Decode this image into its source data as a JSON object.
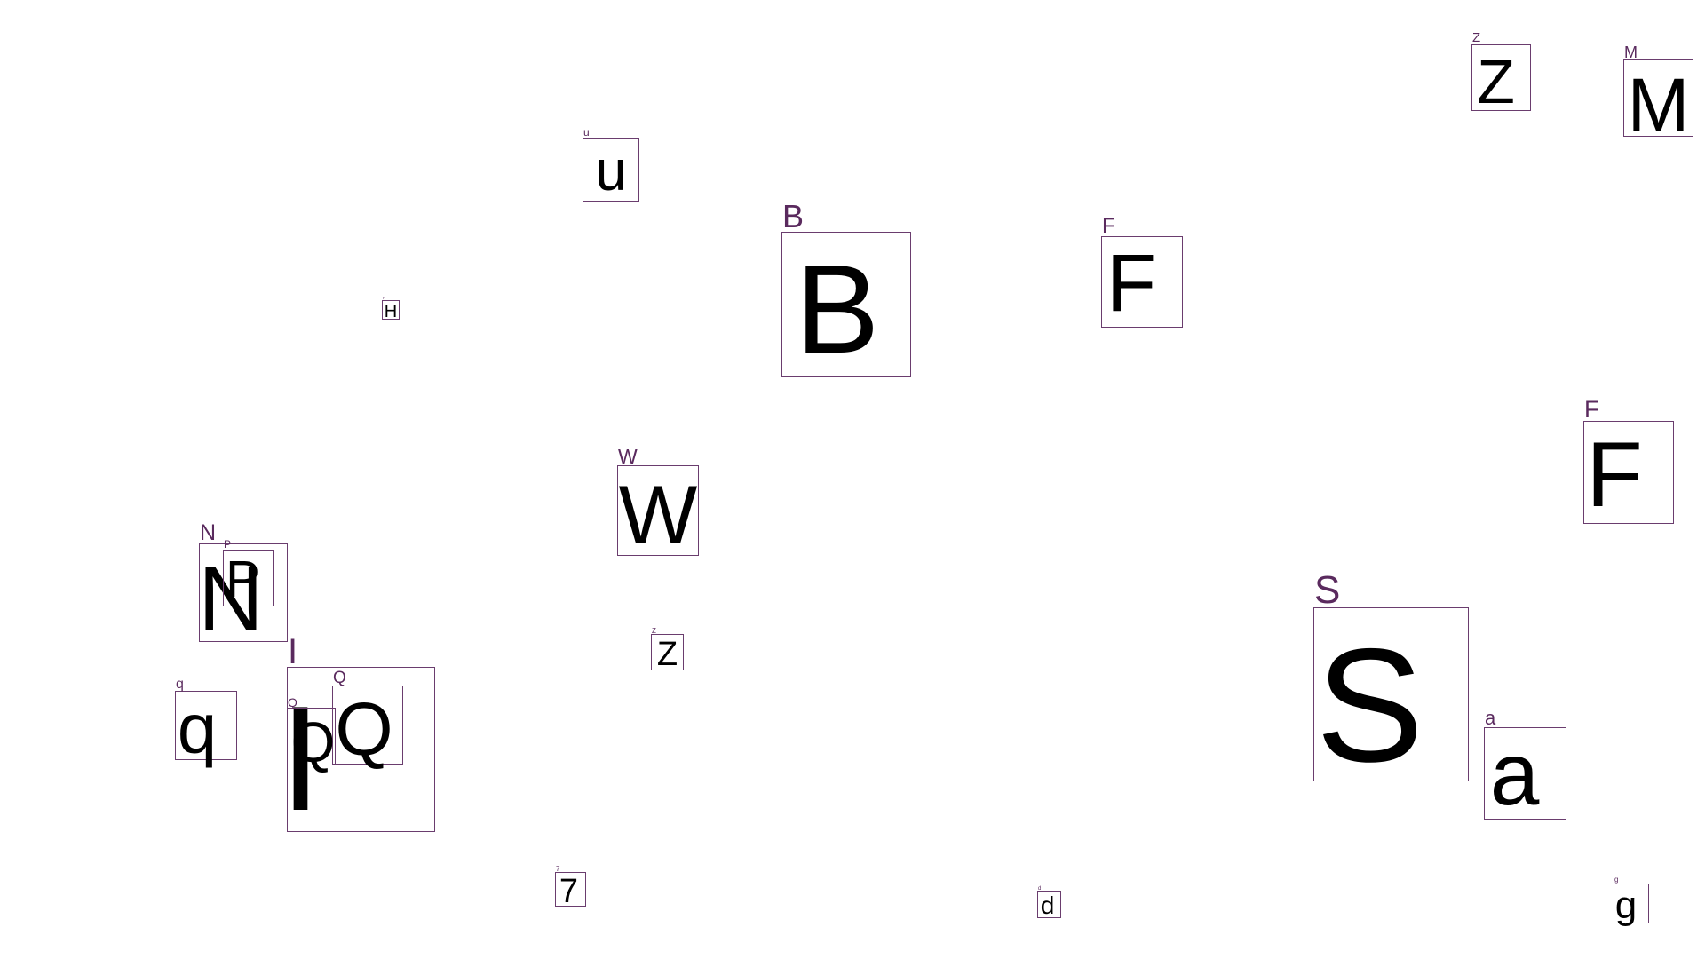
{
  "colors": {
    "background": "#ffffff",
    "box_border": "#6a3d6e",
    "label": "#5a2a5e",
    "glyph": "#000000"
  },
  "detections": [
    {
      "label": "u",
      "glyph": "u"
    },
    {
      "label": "H",
      "glyph": "H"
    },
    {
      "label": "B",
      "glyph": "B"
    },
    {
      "label": "F",
      "glyph": "F"
    },
    {
      "label": "Z",
      "glyph": "Z"
    },
    {
      "label": "M",
      "glyph": "M"
    },
    {
      "label": "F",
      "glyph": "F"
    },
    {
      "label": "W",
      "glyph": "W"
    },
    {
      "label": "N",
      "glyph": "N"
    },
    {
      "label": "P",
      "glyph": "P"
    },
    {
      "label": "Z",
      "glyph": "Z"
    },
    {
      "label": "I",
      "glyph": "I"
    },
    {
      "label": "Q",
      "glyph": "Q"
    },
    {
      "label": "Q",
      "glyph": "Q"
    },
    {
      "label": "q",
      "glyph": "q"
    },
    {
      "label": "S",
      "glyph": "S"
    },
    {
      "label": "a",
      "glyph": "a"
    },
    {
      "label": "7",
      "glyph": "7"
    },
    {
      "label": "d",
      "glyph": "d"
    },
    {
      "label": "g",
      "glyph": "g"
    }
  ]
}
